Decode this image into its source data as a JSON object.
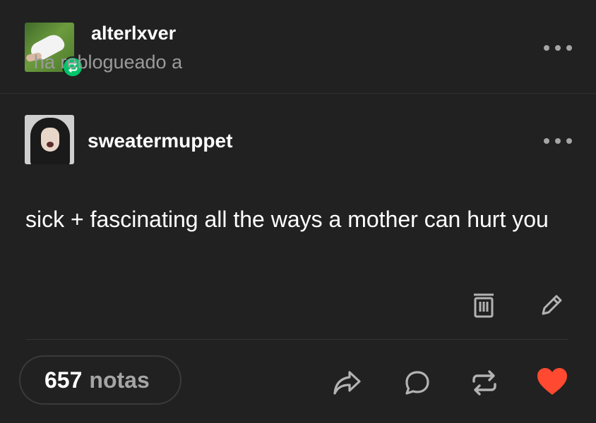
{
  "reblog_header": {
    "username": "alterlxver",
    "action_text": "ha reblogueado a"
  },
  "post": {
    "author": "sweatermuppet",
    "body": "sick + fascinating all the ways a mother can hurt you"
  },
  "footer": {
    "notes_count": "657",
    "notes_label": "notas"
  },
  "icons": {
    "reblog_badge": "reblog-icon",
    "more": "more-dots-icon",
    "delete": "trash-icon",
    "edit": "pencil-icon",
    "share": "share-icon",
    "reply": "reply-bubble-icon",
    "reblog": "reblog-icon",
    "like": "heart-icon"
  },
  "colors": {
    "background": "#212121",
    "badge_green": "#00c46a",
    "like_red": "#ff4930",
    "muted": "#9b9b9b"
  }
}
